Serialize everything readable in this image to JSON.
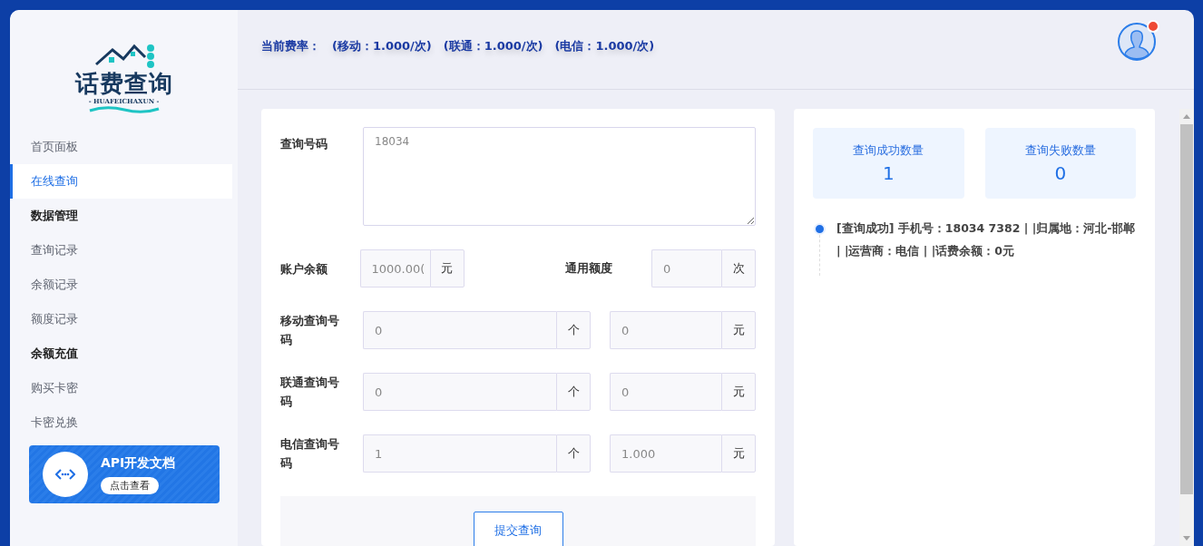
{
  "logo": {
    "title": "话费查询",
    "subtitle": "- HUAFEICHAXUN -"
  },
  "sidebar": {
    "items": [
      {
        "kind": "link",
        "label": "首页面板",
        "selected": false
      },
      {
        "kind": "link",
        "label": "在线查询",
        "selected": true
      },
      {
        "kind": "heading",
        "label": "数据管理"
      },
      {
        "kind": "link",
        "label": "查询记录",
        "selected": false
      },
      {
        "kind": "link",
        "label": "余额记录",
        "selected": false
      },
      {
        "kind": "link",
        "label": "额度记录",
        "selected": false
      },
      {
        "kind": "heading",
        "label": "余额充值"
      },
      {
        "kind": "link",
        "label": "购买卡密",
        "selected": false
      },
      {
        "kind": "link",
        "label": "卡密兑换",
        "selected": false
      }
    ],
    "promo": {
      "title": "API开发文档",
      "button": "点击查看"
    }
  },
  "header": {
    "rates": "当前费率：　(移动：**1.000**/次)　(联通：**1.000**/次)　(电信：**1.000**/次)",
    "notification": true
  },
  "form": {
    "query_label": "查询号码",
    "query_value": "18034",
    "balance": {
      "label": "账户余额",
      "value": "1000.00(",
      "unit": "元"
    },
    "quota": {
      "label": "通用额度",
      "value": "0",
      "unit": "次"
    },
    "rows": [
      {
        "label": "移动查询号码",
        "count": "0",
        "count_unit": "个",
        "amount": "0",
        "amount_unit": "元"
      },
      {
        "label": "联通查询号码",
        "count": "0",
        "count_unit": "个",
        "amount": "0",
        "amount_unit": "元"
      },
      {
        "label": "电信查询号码",
        "count": "1",
        "count_unit": "个",
        "amount": "1.000",
        "amount_unit": "元"
      }
    ],
    "submit": "提交查询"
  },
  "results": {
    "stats": [
      {
        "label": "查询成功数量",
        "value": "1"
      },
      {
        "label": "查询失败数量",
        "value": "0"
      }
    ],
    "log": [
      "[查询成功] 手机号：18034 7382 | |归属地：河北-邯郸 | |运营商：电信 | |话费余额：0元"
    ]
  }
}
